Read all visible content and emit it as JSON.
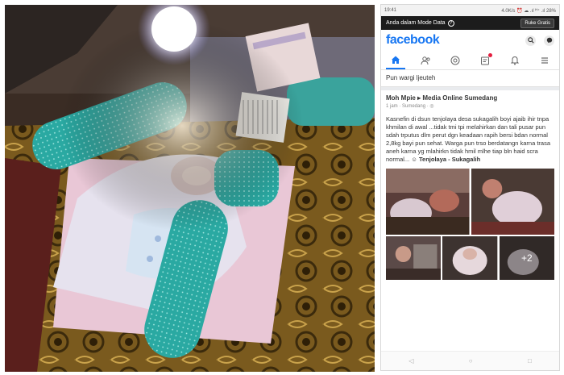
{
  "status_bar": {
    "time": "19:41",
    "indicators": "4.0K/s ⏰ ☁ .ıl ᴴ⁺ .ıl 28%"
  },
  "data_banner": {
    "message": "Anda dalam Mode Data",
    "help_icon": "?",
    "button_label": "Ruke Gratis"
  },
  "header": {
    "logo": "facebook"
  },
  "tabs": [
    {
      "icon": "home-icon",
      "active": true
    },
    {
      "icon": "friends-icon",
      "active": false
    },
    {
      "icon": "groups-icon",
      "active": false
    },
    {
      "icon": "notifications-icon",
      "active": false
    },
    {
      "icon": "bell-icon",
      "active": false
    },
    {
      "icon": "menu-icon",
      "active": false
    }
  ],
  "group": {
    "name": "Pun wargi ljeuteh"
  },
  "post": {
    "author": "Moh Mpie ▸ Media Online Sumedang",
    "meta": "1 jam · Sumedang · ◎",
    "text": "Kasnefin di dsun tenjolaya desa sukagalih boyi ajaib ihir tnpa khmilan di awal ...tidak tmi tpi melahirkan dan tali pusar pun sdah trputus dlm perut dgn keadaan rapih bersi bdan normal 2,8kg bayi pun sehat. Warga pun trso berdatangn karna trasa aneh karna yg mlahirkn tidak hmil mlhe tiap bln haid scra normal... ☺",
    "location": "Tenjolaya - Sukagalih",
    "more_photos": "+2"
  },
  "nav": {
    "back": "◁",
    "home": "○",
    "recent": "□"
  }
}
